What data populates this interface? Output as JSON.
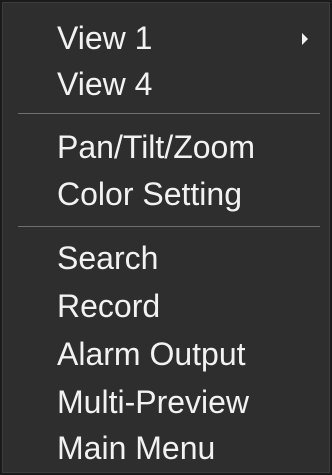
{
  "menu": {
    "items": [
      {
        "label": "View 1",
        "has_submenu": true,
        "submenu_icon": "triangle-right-icon"
      },
      {
        "label": "View 4"
      },
      {
        "label": "Pan/Tilt/Zoom"
      },
      {
        "label": "Color Setting"
      },
      {
        "label": "Search"
      },
      {
        "label": "Record"
      },
      {
        "label": "Alarm Output"
      },
      {
        "label": "Multi-Preview"
      },
      {
        "label": "Main Menu"
      }
    ]
  },
  "colors": {
    "background": "#2e2e2e",
    "text": "#f2f2f2",
    "separator": "#6e6e6e"
  }
}
